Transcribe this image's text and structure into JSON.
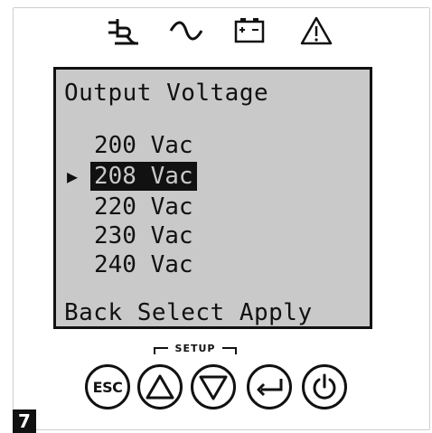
{
  "status_icons": [
    {
      "name": "plug-icon"
    },
    {
      "name": "ac-wave-icon"
    },
    {
      "name": "battery-icon"
    },
    {
      "name": "warning-icon"
    }
  ],
  "lcd": {
    "title": "Output Voltage",
    "options": [
      {
        "label": "200 Vac"
      },
      {
        "label": "208 Vac"
      },
      {
        "label": "220 Vac"
      },
      {
        "label": "230 Vac"
      },
      {
        "label": "240 Vac"
      }
    ],
    "selected_label": "208 Vac",
    "pointer": "▶",
    "footer": "Back Select Apply"
  },
  "setup_label": "SETUP",
  "buttons": {
    "esc_label": "ESC"
  },
  "figure_number": "7"
}
